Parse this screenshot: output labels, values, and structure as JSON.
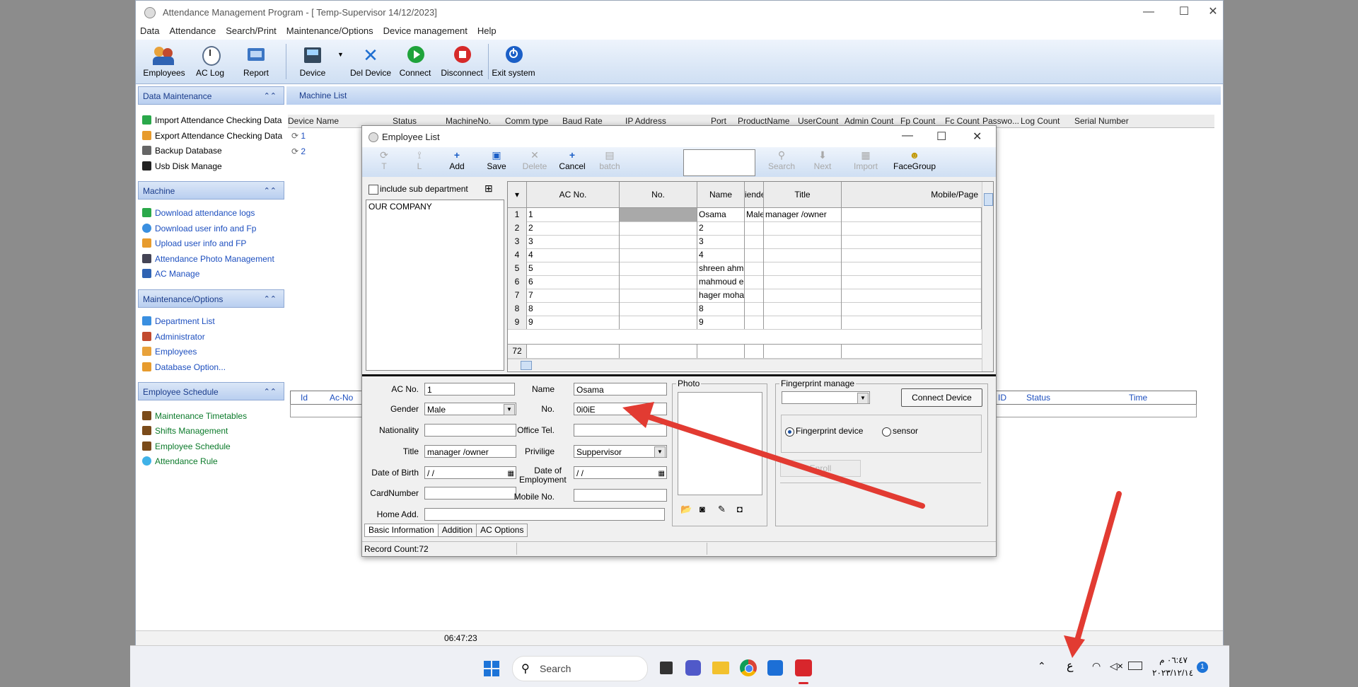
{
  "window": {
    "title": "Attendance Management Program - [ Temp-Supervisor 14/12/2023]",
    "minimize": "—",
    "maximize": "☐",
    "close": "✕"
  },
  "menu": [
    "Data",
    "Attendance",
    "Search/Print",
    "Maintenance/Options",
    "Device management",
    "Help"
  ],
  "toolbar": {
    "employees": "Employees",
    "ac_log": "AC Log",
    "report": "Report",
    "device": "Device",
    "del_device": "Del Device",
    "connect": "Connect",
    "disconnect": "Disconnect",
    "exit": "Exit system"
  },
  "sidebar": {
    "data_maintenance": {
      "title": "Data Maintenance",
      "items": [
        "Import Attendance Checking Data",
        "Export Attendance Checking Data",
        "Backup Database",
        "Usb Disk Manage"
      ]
    },
    "machine": {
      "title": "Machine",
      "items": [
        "Download attendance logs",
        "Download user info and Fp",
        "Upload user info and FP",
        "Attendance Photo Management",
        "AC Manage"
      ]
    },
    "maintenance": {
      "title": "Maintenance/Options",
      "items": [
        "Department List",
        "Administrator",
        "Employees",
        "Database Option..."
      ]
    },
    "schedule": {
      "title": "Employee Schedule",
      "items": [
        "Maintenance Timetables",
        "Shifts Management",
        "Employee Schedule",
        "Attendance Rule"
      ]
    }
  },
  "machine_list": {
    "title": "Machine List",
    "columns": [
      "Device Name",
      "Status",
      "MachineNo.",
      "Comm type",
      "Baud Rate",
      "IP Address",
      "Port",
      "ProductName",
      "UserCount",
      "Admin Count",
      "Fp Count",
      "Fc Count",
      "Passwo...",
      "Log Count",
      "Serial Number"
    ],
    "rows": [
      "1",
      "2"
    ]
  },
  "log_grid": {
    "left_cols": [
      "Id",
      "Ac-No"
    ],
    "right_cols": [
      "ID",
      "Status",
      "Time"
    ]
  },
  "status_time": "06:47:23",
  "employee_dialog": {
    "title": "Employee List",
    "toolbar": {
      "add": "Add",
      "save": "Save",
      "delete": "Delete",
      "cancel": "Cancel",
      "batch": "batch",
      "search": "Search",
      "next": "Next",
      "import": "Import",
      "facegroup": "FaceGroup",
      "t_label": "T",
      "l_label": "L"
    },
    "include_sub": "include sub department",
    "tree_root": "OUR COMPANY",
    "columns": [
      "AC No.",
      "No.",
      "Name",
      "iende",
      "Title",
      "Mobile/Page"
    ],
    "rows": [
      {
        "n": "1",
        "ac": "1",
        "name": "Osama",
        "gender": "Male",
        "title": "manager /owner"
      },
      {
        "n": "2",
        "ac": "2",
        "name": "2",
        "gender": "",
        "title": ""
      },
      {
        "n": "3",
        "ac": "3",
        "name": "3",
        "gender": "",
        "title": ""
      },
      {
        "n": "4",
        "ac": "4",
        "name": "4",
        "gender": "",
        "title": ""
      },
      {
        "n": "5",
        "ac": "5",
        "name": "shreen ahmed",
        "gender": "",
        "title": ""
      },
      {
        "n": "6",
        "ac": "6",
        "name": "mahmoud em...",
        "gender": "",
        "title": ""
      },
      {
        "n": "7",
        "ac": "7",
        "name": "hager moham...",
        "gender": "",
        "title": ""
      },
      {
        "n": "8",
        "ac": "8",
        "name": "8",
        "gender": "",
        "title": ""
      },
      {
        "n": "9",
        "ac": "9",
        "name": "9",
        "gender": "",
        "title": ""
      }
    ],
    "total_rows": "72",
    "form": {
      "ac_no_label": "AC No.",
      "ac_no": "1",
      "name_label": "Name",
      "name": "Osama",
      "gender_label": "Gender",
      "gender": "Male",
      "no_label": "No.",
      "no": "0i0iE",
      "nationality_label": "Nationality",
      "nationality": "",
      "office_tel_label": "Office Tel.",
      "office_tel": "",
      "title_label": "Title",
      "title": "manager /owner",
      "privilege_label": "Privilige",
      "privilege": "Suppervisor",
      "dob_label": "Date of Birth",
      "dob": " /  /",
      "doe_label": "Date of Employment",
      "doe": " /  /",
      "card_label": "CardNumber",
      "card": "",
      "mobile_label": "Mobile No.",
      "mobile": "",
      "home_label": "Home Add.",
      "home": "",
      "photo_label": "Photo",
      "fp_label": "Fingerprint manage",
      "connect_device": "Connect Device",
      "fp_device": "Fingerprint device",
      "sensor": "sensor",
      "enroll": "Enroll"
    },
    "tabs": [
      "Basic Information",
      "Addition",
      "AC Options"
    ],
    "record_count": "Record Count:72"
  },
  "taskbar": {
    "search": "Search",
    "lang": "ع",
    "time": "٠٦:٤٧ م",
    "date": "٢٠٢٣/١٢/١٤",
    "badge": "1"
  }
}
